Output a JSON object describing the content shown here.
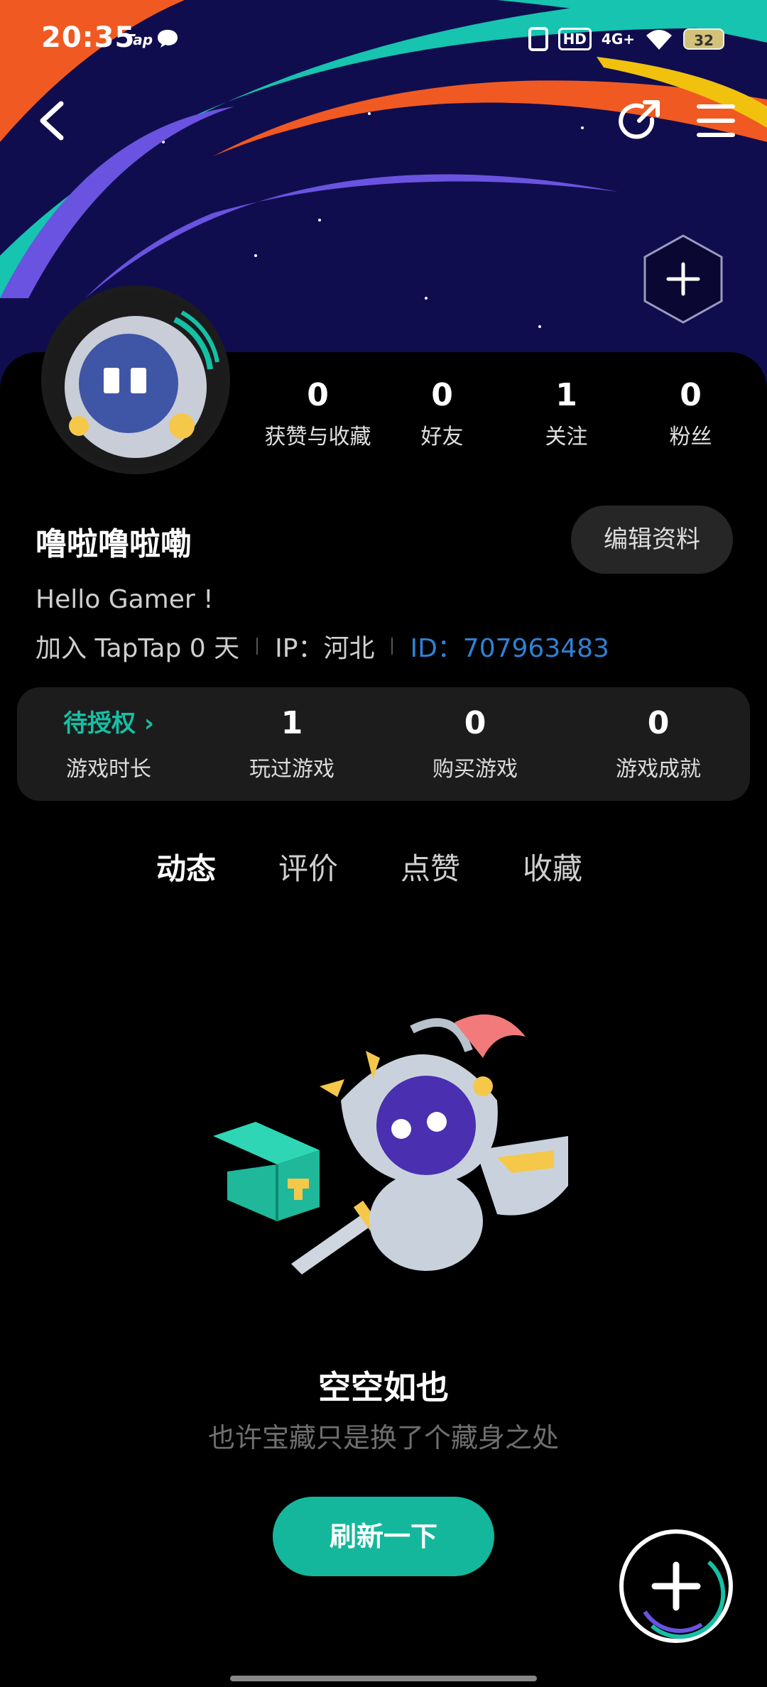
{
  "status_bar": {
    "time": "20:35",
    "tap_label": "Tap",
    "hd": "HD",
    "network": "4G+",
    "battery": "32"
  },
  "profile": {
    "name": "噜啦噜啦嘞",
    "edit_label": "编辑资料",
    "bio": "Hello Gamer !",
    "joined": "加入 TapTap 0 天",
    "ip": "IP：河北",
    "id": "ID：707963483",
    "stats": [
      {
        "value": "0",
        "label": "获赞与收藏"
      },
      {
        "value": "0",
        "label": "好友"
      },
      {
        "value": "1",
        "label": "关注"
      },
      {
        "value": "0",
        "label": "粉丝"
      }
    ]
  },
  "game_stats": [
    {
      "value": "待授权 ›",
      "label": "游戏时长"
    },
    {
      "value": "1",
      "label": "玩过游戏"
    },
    {
      "value": "0",
      "label": "购买游戏"
    },
    {
      "value": "0",
      "label": "游戏成就"
    }
  ],
  "tabs": [
    {
      "label": "动态",
      "active": true
    },
    {
      "label": "评价",
      "active": false
    },
    {
      "label": "点赞",
      "active": false
    },
    {
      "label": "收藏",
      "active": false
    }
  ],
  "empty_state": {
    "title": "空空如也",
    "subtitle": "也许宝藏只是换了个藏身之处",
    "refresh_label": "刷新一下"
  },
  "colors": {
    "accent": "#15c0a5",
    "id_blue": "#2f82d4",
    "banner_bg": "#100d4e"
  }
}
